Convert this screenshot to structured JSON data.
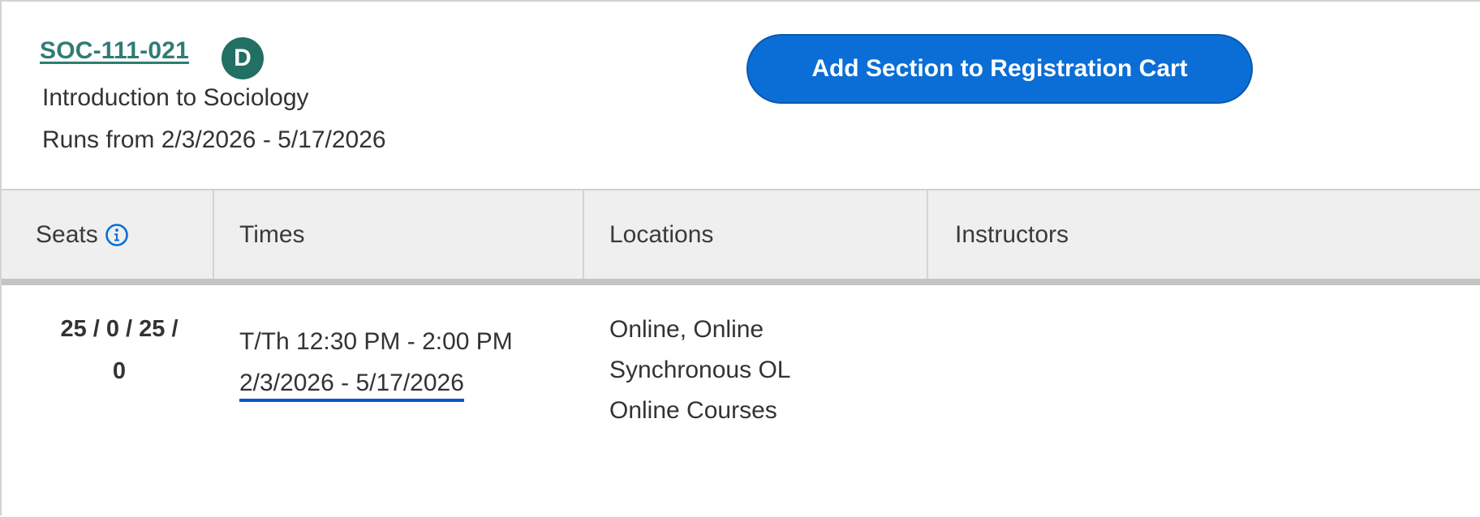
{
  "section": {
    "code": "SOC-111-021",
    "badge": "D",
    "title": "Introduction to Sociology",
    "runs": "Runs from 2/3/2026 - 5/17/2026",
    "add_button_label": "Add Section to Registration Cart"
  },
  "table": {
    "headers": {
      "seats": "Seats",
      "times": "Times",
      "locations": "Locations",
      "instructors": "Instructors"
    },
    "row": {
      "seats_line1": "25 / 0 / 25 /",
      "seats_line2": "0",
      "time": "T/Th 12:30 PM - 2:00 PM",
      "date_range": "2/3/2026 - 5/17/2026",
      "locations": [
        "Online, Online",
        "Synchronous OL",
        "Online Courses"
      ],
      "instructors": ""
    }
  },
  "icons": {
    "seats_info": "info-circle-icon"
  },
  "colors": {
    "course_code": "#2e7d74",
    "badge_bg": "#226f63",
    "button_bg": "#0a6ed6",
    "date_underline": "#0a55c8",
    "header_bg": "#efefef"
  }
}
